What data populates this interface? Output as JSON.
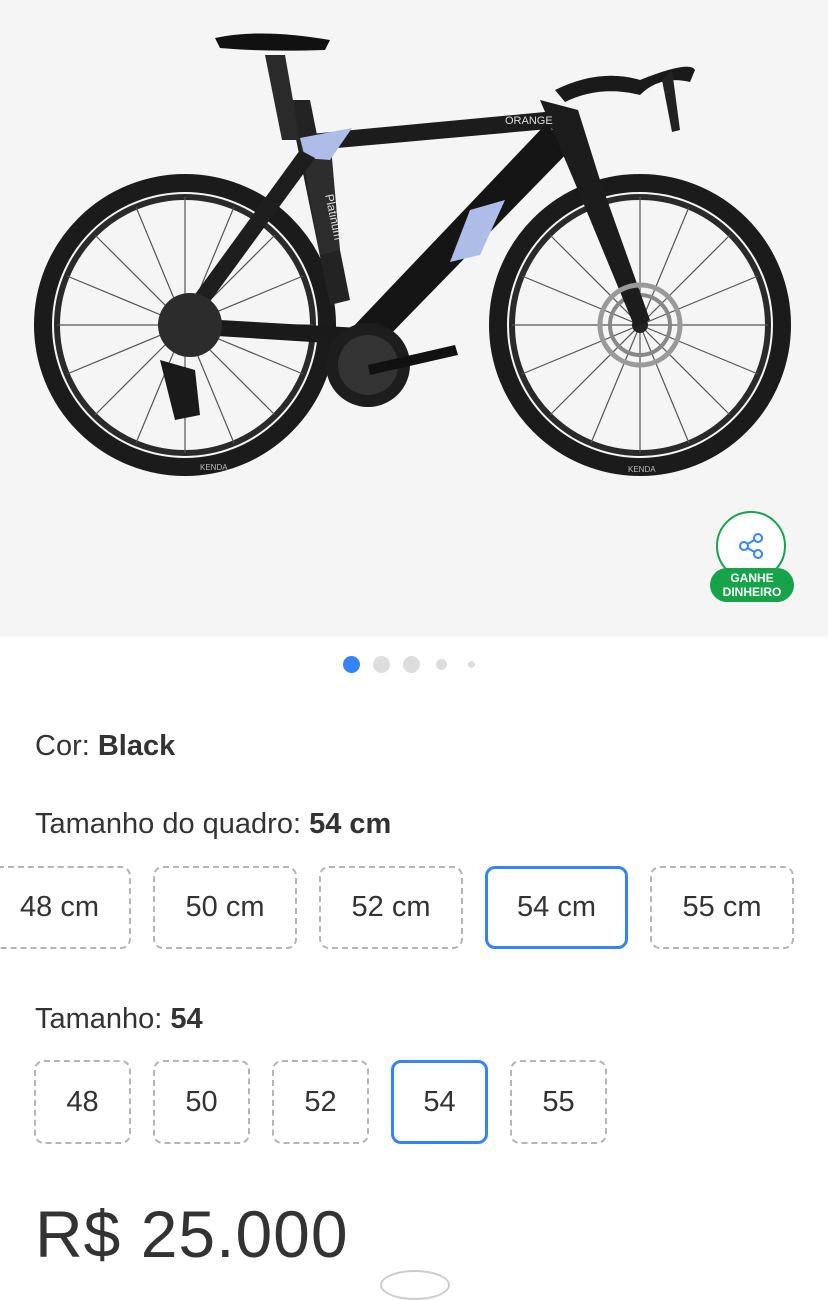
{
  "product_image": {
    "frame_text": "ORANGE",
    "top_tube_text": "Platinum",
    "tire_brand": "KENDA",
    "colors": {
      "background": "#f5f5f5",
      "accent_panel": "#aebce8"
    }
  },
  "share_button": {
    "icon": "share-icon",
    "line1": "GANHE",
    "line2": "DINHEIRO",
    "color": "#16a34a"
  },
  "carousel": {
    "total": 5,
    "active_index": 0,
    "active_color": "#3483fa"
  },
  "color_selector": {
    "label": "Cor:",
    "value": "Black"
  },
  "frame_size": {
    "label": "Tamanho do quadro:",
    "value": "54 cm",
    "options": [
      "48 cm",
      "50 cm",
      "52 cm",
      "54 cm",
      "55 cm"
    ],
    "selected_index": 3
  },
  "size": {
    "label": "Tamanho:",
    "value": "54",
    "options": [
      "48",
      "50",
      "52",
      "54",
      "55"
    ],
    "selected_index": 3
  },
  "price": {
    "text": "R$ 25.000"
  },
  "colors": {
    "selected_border": "#3483fa",
    "chip_border": "#b5b5b5",
    "text": "#333333"
  }
}
